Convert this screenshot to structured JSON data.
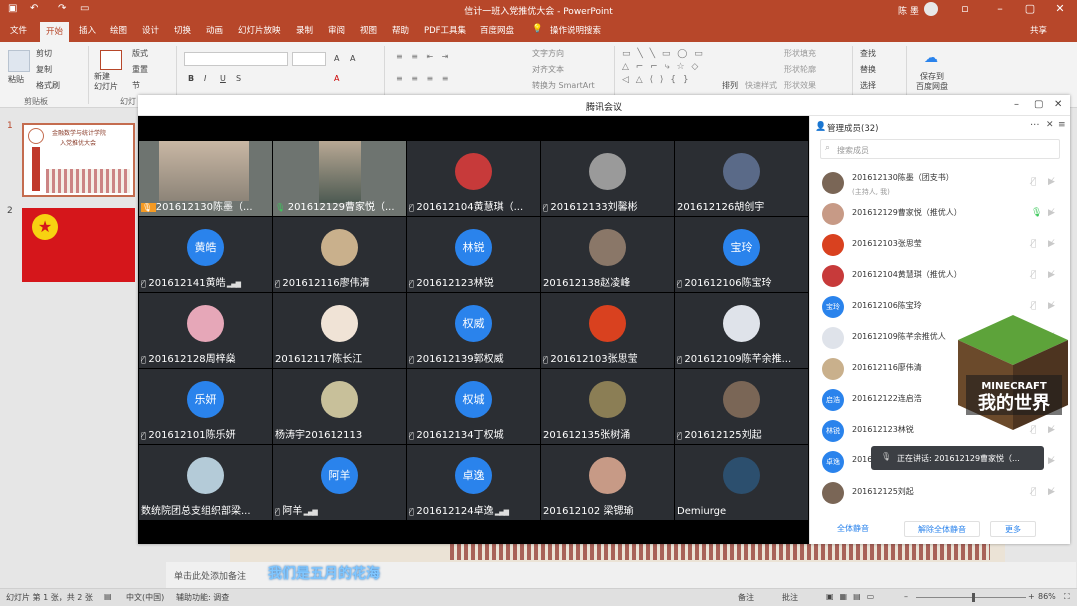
{
  "powerpoint": {
    "title": "信计一班入党推优大会 - PowerPoint",
    "user": "陈 墨",
    "share": "共享",
    "tabs": [
      "文件",
      "开始",
      "插入",
      "绘图",
      "设计",
      "切换",
      "动画",
      "幻灯片放映",
      "录制",
      "审阅",
      "视图",
      "帮助",
      "PDF工具集",
      "百度网盘",
      "操作说明搜索"
    ],
    "active_tab": "开始",
    "ribbon": {
      "paste": "粘贴",
      "cut": "剪切",
      "copy": "复制",
      "format_painter": "格式刷",
      "clipboard_group": "剪贴板",
      "new_slide": "新建\n幻灯片",
      "layout": "版式",
      "reset": "重置",
      "section": "节",
      "slides_group": "幻灯",
      "text_direction": "文字方向",
      "align_text": "对齐文本",
      "smartart": "转换为 SmartArt",
      "arrange": "排列",
      "quick_styles": "快速样式",
      "shape_fill": "形状填充",
      "shape_outline": "形状轮廓",
      "shape_effects": "形状效果",
      "find": "查找",
      "replace": "替换",
      "select": "选择",
      "save_baidu": "保存到\n百度网盘"
    },
    "slide_numbers": [
      "1",
      "2"
    ],
    "thumb1_lines": [
      "金融数学与统计学院",
      "入党推优大会"
    ],
    "notes_placeholder": "单击此处添加备注",
    "caption": "我们是五月的花海",
    "status": {
      "slide_info": "幻灯片 第 1 张，共 2 张",
      "language": "中文(中国)",
      "accessibility": "辅助功能: 调查",
      "notes": "备注",
      "comments": "批注",
      "zoom": "86%"
    }
  },
  "meeting": {
    "title": "腾讯会议",
    "member_panel_title": "管理成员(32)",
    "search_placeholder": "搜索成员",
    "grid": [
      {
        "name": "201612130陈墨（...",
        "mic": "host",
        "video": true
      },
      {
        "name": "201612129曹家悦（...",
        "mic": "on",
        "video": true
      },
      {
        "name": "201612104黄慧琪（...",
        "mic": "muted",
        "avatar": "photo-red-bow"
      },
      {
        "name": "201612133刘馨彬",
        "mic": "muted",
        "avatar": "photo-grey"
      },
      {
        "name": "201612126胡创宇",
        "mic": "none",
        "avatar": "photo-anime"
      },
      {
        "name": "201612141黄皓",
        "mic": "muted",
        "avatar_text": "黄皓",
        "signal": true
      },
      {
        "name": "201612116廖伟清",
        "mic": "muted",
        "avatar": "photo-cartoon"
      },
      {
        "name": "201612123林锐",
        "mic": "muted",
        "avatar_text": "林锐"
      },
      {
        "name": "201612138赵凌峰",
        "mic": "none",
        "avatar": "photo-anime2"
      },
      {
        "name": "201612106陈宝玲",
        "mic": "muted",
        "avatar_text": "宝玲"
      },
      {
        "name": "201612128周梓燊",
        "mic": "muted",
        "avatar": "photo-pink"
      },
      {
        "name": "201612117陈长江",
        "mic": "none",
        "avatar": "photo-face"
      },
      {
        "name": "201612139郭权威",
        "mic": "muted",
        "avatar_text": "权威"
      },
      {
        "name": "201612103张思莹",
        "mic": "muted",
        "avatar": "photo-fire"
      },
      {
        "name": "201612109陈芊余推...",
        "mic": "muted",
        "avatar": "photo-sketch"
      },
      {
        "name": "201612101陈乐妍",
        "mic": "muted",
        "avatar_text": "乐妍"
      },
      {
        "name": "杨涛宇201612113",
        "mic": "none",
        "avatar": "photo-dog"
      },
      {
        "name": "201612134丁权城",
        "mic": "muted",
        "avatar_text": "权城"
      },
      {
        "name": "201612135张树涌",
        "mic": "none",
        "avatar": "photo-cat"
      },
      {
        "name": "201612125刘起",
        "mic": "muted",
        "avatar": "photo-boy"
      },
      {
        "name": "数统院团总支组织部梁...",
        "mic": "none",
        "avatar": "photo-goose"
      },
      {
        "name": "阿羊",
        "mic": "muted",
        "avatar_text": "阿羊",
        "signal": true
      },
      {
        "name": "201612124卓逸",
        "mic": "muted",
        "avatar_text": "卓逸",
        "signal": true
      },
      {
        "name": "201612102 梁锶瑜",
        "mic": "none",
        "avatar": "photo-girl"
      },
      {
        "name": "Demiurge",
        "mic": "none",
        "avatar": "photo-space"
      }
    ],
    "members": [
      {
        "name": "201612130陈墨（团支书）",
        "sub": "(主持人, 我)",
        "mic": "muted"
      },
      {
        "name": "201612129曹家悦（推优人）",
        "mic": "on"
      },
      {
        "name": "201612103张思莹",
        "mic": "muted"
      },
      {
        "name": "201612104黄慧琪（推优人）",
        "mic": "muted"
      },
      {
        "name": "201612106陈宝玲",
        "avatar_text": "宝玲",
        "mic": "muted"
      },
      {
        "name": "201612109陈芊余推优人",
        "mic": "muted"
      },
      {
        "name": "201612116廖伟清",
        "mic": "muted"
      },
      {
        "name": "201612122连启浩",
        "avatar_text": "启浩",
        "mic": "muted"
      },
      {
        "name": "201612123林锐",
        "avatar_text": "林锐",
        "mic": "muted"
      },
      {
        "name": "201612",
        "avatar_text": "卓逸",
        "mic": "muted"
      },
      {
        "name": "201612125刘起",
        "mic": "muted"
      }
    ],
    "speaking": "正在讲话: 201612129曹家悦（...",
    "mute_all": "全体静音",
    "unmute_all": "解除全体静音",
    "more": "更多"
  },
  "colors": {
    "ppt_red": "#b7472a",
    "tm_blue": "#2a83ec",
    "mic_on": "#3cc95b"
  }
}
